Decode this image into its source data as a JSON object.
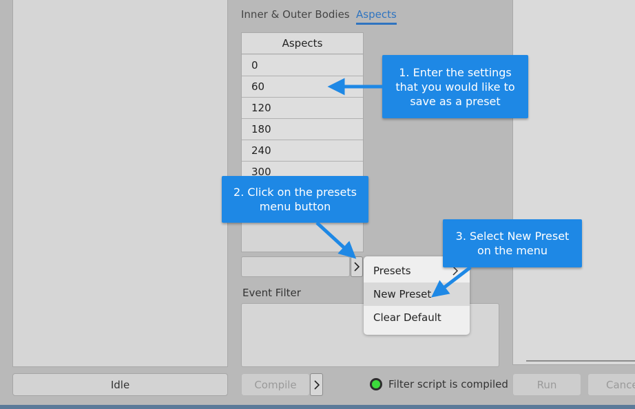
{
  "tabs": [
    {
      "label": "Inner & Outer Bodies",
      "active": false
    },
    {
      "label": "Aspects",
      "active": true
    }
  ],
  "aspects_table": {
    "header": "Aspects",
    "rows": [
      "0",
      "60",
      "120",
      "180",
      "240",
      "300"
    ]
  },
  "event_filter": {
    "label": "Event Filter"
  },
  "presets_menu": {
    "items": [
      "Presets",
      "New Preset",
      "Clear Default"
    ],
    "highlighted": "New Preset"
  },
  "callouts": {
    "step1": "1. Enter the settings that you would like to save as a preset",
    "step2": "2. Click on the presets menu button",
    "step3": "3. Select New Preset on the menu"
  },
  "bottom_bar": {
    "idle_label": "Idle",
    "compile_label": "Compile",
    "status_text": "Filter script is compiled",
    "run_label": "Run",
    "cancel_label": "Cancel"
  },
  "colors": {
    "accent": "#2f74c0",
    "callout": "#1e88e5",
    "status_led": "#3cdc3c"
  }
}
